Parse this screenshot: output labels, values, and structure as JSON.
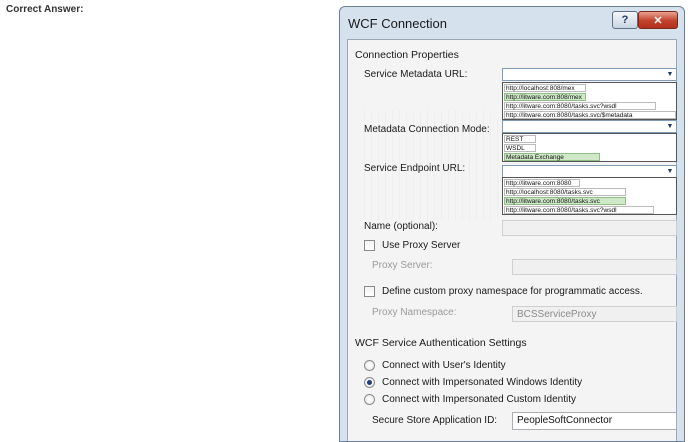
{
  "page": {
    "caption": "Correct Answer:"
  },
  "dialog": {
    "title": "WCF Connection",
    "help_glyph": "?",
    "close_glyph": "✕",
    "connection_properties": "Connection Properties",
    "service_metadata_url": {
      "label": "Service Metadata URL:",
      "options": [
        "http://localhost:808/mex",
        "http://litware.com:808/mex",
        "http://litware.com:8080/tasks.svc?wsdl",
        "http://litware.com:8080/tasks.svc/$metadata"
      ],
      "selected_index": 1
    },
    "metadata_connection_mode": {
      "label": "Metadata Connection Mode:",
      "options": [
        "REST",
        "WSDL",
        "Metadata Exchange"
      ],
      "selected_index": 2
    },
    "service_endpoint_url": {
      "label": "Service Endpoint URL:",
      "options": [
        "http://litware.com:8080",
        "http://localhost:8080/tasks.svc",
        "http://litware.com:8080/tasks.svc",
        "http://litware.com:8080/tasks.svc?wsdl"
      ],
      "selected_index": 2
    },
    "name_optional": {
      "label": "Name (optional):",
      "value": ""
    },
    "use_proxy_server": {
      "label": "Use Proxy Server",
      "checked": false
    },
    "proxy_server": {
      "label": "Proxy Server:",
      "value": ""
    },
    "define_custom_proxy": {
      "label": "Define custom proxy namespace for programmatic access.",
      "checked": false
    },
    "proxy_namespace": {
      "label": "Proxy Namespace:",
      "value": "BCSServiceProxy"
    },
    "auth_settings": "WCF Service Authentication Settings",
    "auth_options": [
      {
        "label": "Connect with User's Identity",
        "selected": false
      },
      {
        "label": "Connect with Impersonated Windows Identity",
        "selected": true
      },
      {
        "label": "Connect with Impersonated Custom Identity",
        "selected": false
      }
    ],
    "secure_store_app_id": {
      "label": "Secure Store Application ID:",
      "value": "PeopleSoftConnector"
    }
  }
}
